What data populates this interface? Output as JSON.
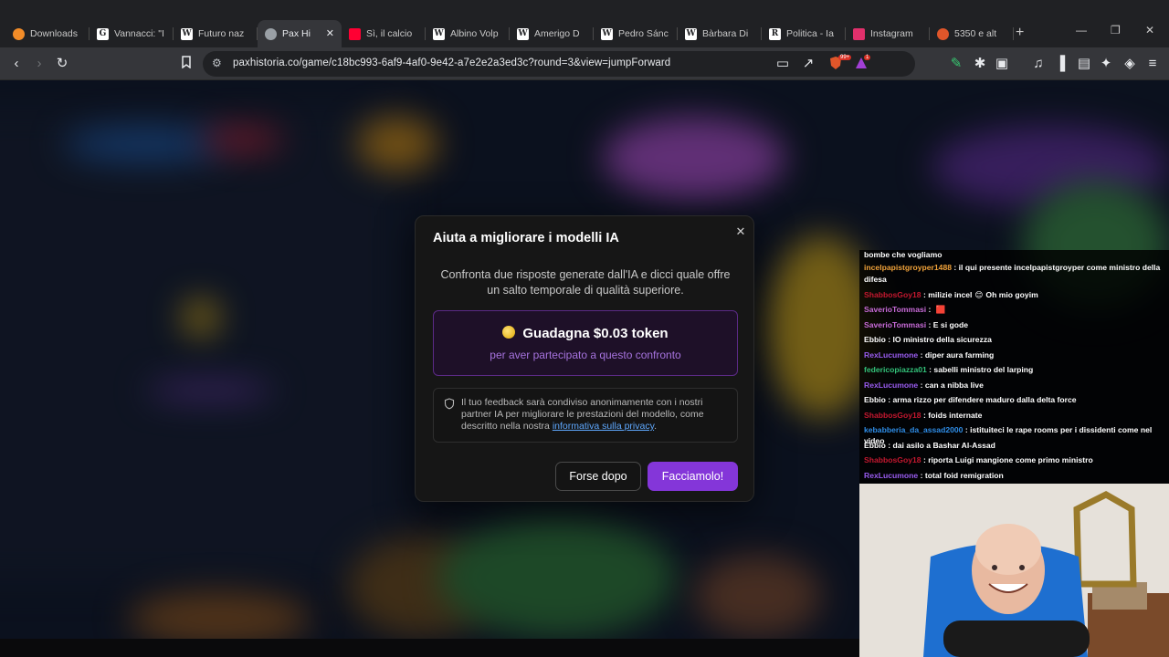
{
  "browser": {
    "tabs": [
      {
        "title": "Downloads",
        "icon": "vlc-icon",
        "color": "#f28c28"
      },
      {
        "title": "Vannacci: \"I",
        "icon": "g-icon",
        "color": "#ffffff"
      },
      {
        "title": "Futuro naz",
        "icon": "wikipedia-icon",
        "color": "#ffffff"
      },
      {
        "title": "Pax Hi",
        "icon": "pax-icon",
        "color": "#9aa0a6",
        "active": true
      },
      {
        "title": "Sì, il calcio",
        "icon": "youtube-icon",
        "color": "#ff0033"
      },
      {
        "title": "Albino Volp",
        "icon": "wikipedia-icon",
        "color": "#ffffff"
      },
      {
        "title": "Amerigo D",
        "icon": "wikipedia-icon",
        "color": "#ffffff"
      },
      {
        "title": "Pedro Sánc",
        "icon": "wikipedia-icon",
        "color": "#ffffff"
      },
      {
        "title": "Bàrbara Di",
        "icon": "wikipedia-icon",
        "color": "#ffffff"
      },
      {
        "title": "Politica - Ia",
        "icon": "r-icon",
        "color": "#ffffff"
      },
      {
        "title": "Instagram",
        "icon": "instagram-icon",
        "color": "#e1306c"
      },
      {
        "title": "5350 e alt",
        "icon": "brave-icon",
        "color": "#e0562a"
      }
    ],
    "url": "paxhistoria.co/game/c18bc993-6af9-4af0-9e42-a7e2e2a3ed3c?round=3&view=jumpForward",
    "brave_badge": "99+",
    "alert_badge": "1"
  },
  "modal": {
    "title": "Aiuta a migliorare i modelli IA",
    "description": "Confronta due risposte generate dall'IA e dicci quale offre un salto temporale di qualità superiore.",
    "reward_title": "Guadagna $0.03 token",
    "reward_subtitle": "per aver partecipato a questo confronto",
    "privacy_text": "Il tuo feedback sarà condiviso anonimamente con i nostri partner IA per migliorare le prestazioni del modello, come descritto nella nostra ",
    "privacy_link": "informativa sulla privacy",
    "privacy_end": ".",
    "later_label": "Forse dopo",
    "accept_label": "Facciamolo!",
    "accent": "#8436d9"
  },
  "chat": {
    "messages": [
      {
        "user": "",
        "color": "#ffffff",
        "text": "bombe che vogliamo"
      },
      {
        "user": "incelpapistgroyper1488",
        "color": "#f2a33a",
        "text": "il qui presente incelpapistgroyper come ministro della"
      },
      {
        "user": "",
        "color": "#ffffff",
        "text": "difesa"
      },
      {
        "user": "ShabbosGoy18",
        "color": "#c4182f",
        "text": "milizie incel",
        "emote": "😊",
        "after": "Oh mio goyim"
      },
      {
        "user": "SaverioTommasi",
        "color": "#c86bd8",
        "text": "",
        "emote": "🟥"
      },
      {
        "user": "SaverioTommasi",
        "color": "#c86bd8",
        "text": "E si gode"
      },
      {
        "user": "Ebbio",
        "color": "#ffffff",
        "text": "IO ministro della sicurezza"
      },
      {
        "user": "RexLucumone",
        "color": "#9a5cf0",
        "text": "diper aura farming"
      },
      {
        "user": "federicopiazza01",
        "color": "#33c27a",
        "text": "sabelli ministro del larping"
      },
      {
        "user": "RexLucumone",
        "color": "#9a5cf0",
        "text": "can a nibba live"
      },
      {
        "user": "Ebbio",
        "color": "#ffffff",
        "text": "arma rizzo per difendere maduro dalla delta force"
      },
      {
        "user": "ShabbosGoy18",
        "color": "#c4182f",
        "text": "foids internate"
      },
      {
        "user": "kebabberia_da_assad2000",
        "color": "#2f8ee8",
        "text": "istituiteci le rape rooms per i dissidenti come nel video"
      },
      {
        "user": "Ebbio",
        "color": "#ffffff",
        "text": "dai asilo a Bashar Al-Assad"
      },
      {
        "user": "ShabbosGoy18",
        "color": "#c4182f",
        "text": "riporta Luigi mangione come primo ministro"
      },
      {
        "user": "RexLucumone",
        "color": "#9a5cf0",
        "text": "total foid remigration"
      }
    ]
  }
}
